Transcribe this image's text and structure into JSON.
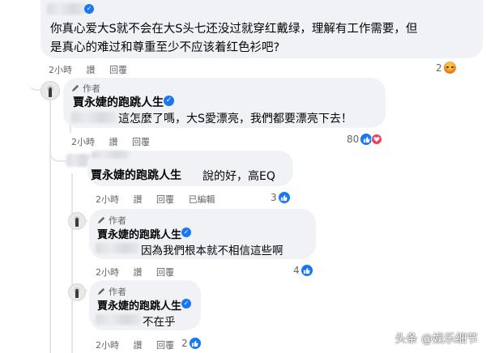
{
  "top_comment": {
    "text_line1": "你真心爱大S就不会在大S头七还没过就穿红戴绿，理解有工作需要，但",
    "text_line2": "是真心的难过和尊重至少不应该着红色衫吧?",
    "time": "2小時",
    "like": "讚",
    "reply": "回覆",
    "reaction_count": "2",
    "reaction_icon": "angry-icon"
  },
  "reply1": {
    "badge": "作者",
    "name": "賈永婕的跑跳人生",
    "text": "這怎麼了嗎，大S愛漂亮，我們都要漂亮下去！",
    "time": "2小時",
    "like": "讚",
    "reply": "回覆",
    "reaction_count": "80"
  },
  "reply2": {
    "name": "賈永婕的跑跳人生",
    "text": "說的好，高EQ",
    "time": "2小時",
    "like": "讚",
    "reply": "回覆",
    "edited": "已編輯",
    "reaction_count": "3"
  },
  "reply3": {
    "badge": "作者",
    "name": "賈永婕的跑跳人生",
    "text": "因為我們根本就不相信這些啊",
    "time": "2小時",
    "like": "讚",
    "reply": "回覆",
    "reaction_count": "4"
  },
  "reply4": {
    "badge": "作者",
    "name": "賈永婕的跑跳人生",
    "text": "不在乎",
    "time": "2小時",
    "like": "讚",
    "reply": "回覆",
    "reaction_count": "2"
  },
  "watermark": "头条 @娱乐细节",
  "colors": {
    "bubble": "#f0f2f5",
    "meta": "#65676b",
    "like_blue": "#1877f2",
    "love_red": "#f33e58"
  }
}
